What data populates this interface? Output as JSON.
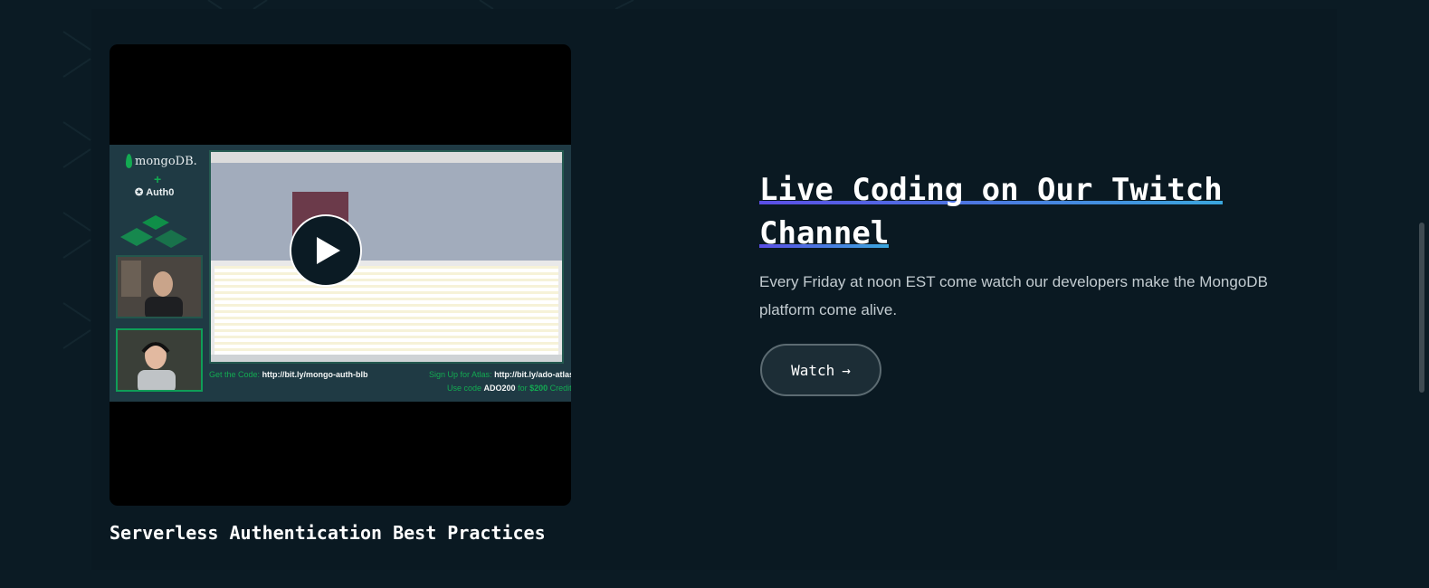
{
  "video": {
    "title": "Serverless Authentication Best Practices",
    "thumbnail": {
      "brand_primary": "mongoDB.",
      "brand_plus": "+",
      "brand_secondary": "Auth0",
      "caption_code_label": "Get the Code:",
      "caption_code_url": "http://bit.ly/mongo-auth-blb",
      "caption_signup_label": "Sign Up for Atlas:",
      "caption_signup_url": "http://bit.ly/ado-atlas",
      "caption_use": "Use code",
      "caption_code": "ADO200",
      "caption_for": "for",
      "caption_amount": "$200",
      "caption_credit": "Credit"
    },
    "play_icon": "play-icon"
  },
  "promo": {
    "headline_line1": "Live Coding on Our Twitch",
    "headline_line2": "Channel",
    "description": "Every Friday at noon EST come watch our developers make the MongoDB platform come alive.",
    "watch_label": "Watch",
    "watch_icon": "→"
  },
  "colors": {
    "background": "#0b1b24",
    "accent_green": "#13aa52",
    "underline_start": "#5b4ee6",
    "underline_end": "#3aa6dd"
  }
}
